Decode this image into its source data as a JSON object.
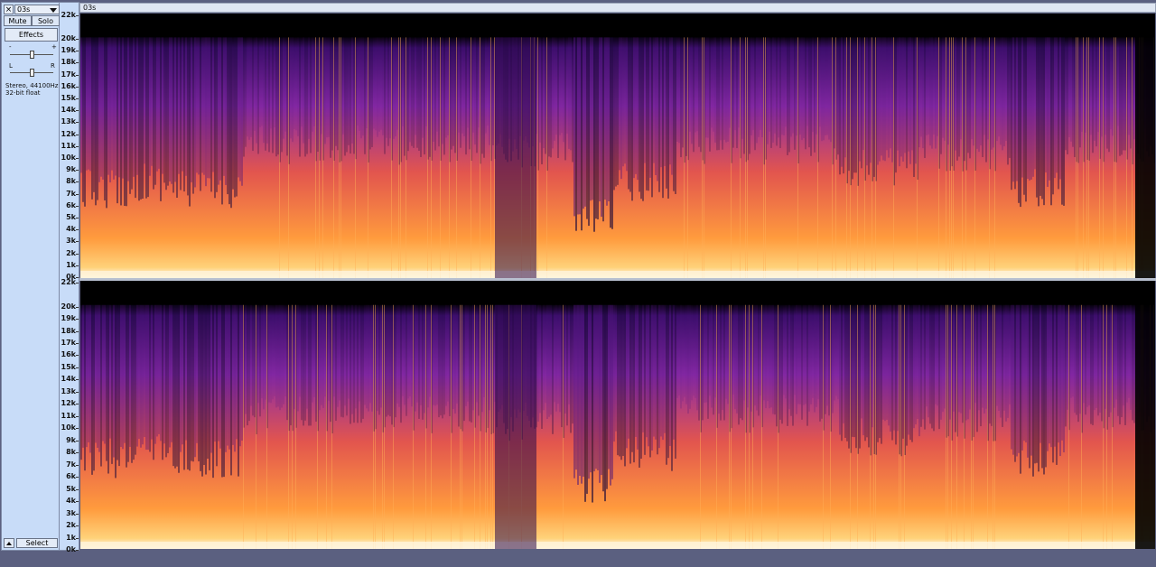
{
  "track": {
    "name": "03s",
    "close_label": "×",
    "mute_label": "Mute",
    "solo_label": "Solo",
    "effects_label": "Effects",
    "gain_minus": "-",
    "gain_plus": "+",
    "pan_left": "L",
    "pan_right": "R",
    "format_line1": "Stereo, 44100Hz",
    "format_line2": "32-bit float",
    "select_label": "Select"
  },
  "clip": {
    "title": "03s"
  },
  "ruler": {
    "labels": [
      "22k",
      "20k",
      "19k",
      "18k",
      "17k",
      "16k",
      "15k",
      "14k",
      "13k",
      "12k",
      "11k",
      "10k",
      "9k",
      "8k",
      "7k",
      "6k",
      "5k",
      "4k",
      "3k",
      "2k",
      "1k",
      "0k"
    ]
  },
  "colors": {
    "panel_bg": "#c8dcf8",
    "spectrogram_low": "#000000",
    "spectrogram_mid": "#7a1fa2",
    "spectrogram_high": "#ff9f3a",
    "spectrogram_peak": "#ffffff"
  }
}
